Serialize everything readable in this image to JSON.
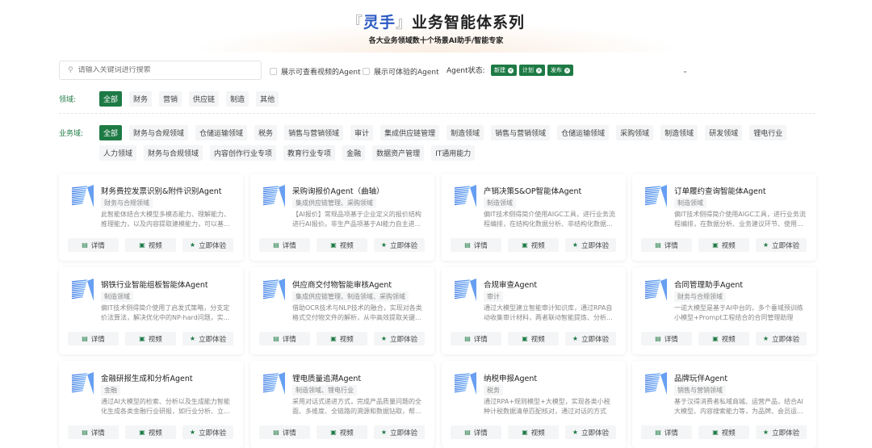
{
  "header": {
    "bracket_open": "『",
    "brand": "灵手",
    "bracket_close": "』",
    "title_rest": "业务智能体系列",
    "subtitle": "各大业务领域数十个场景AI助手/智能专家"
  },
  "search": {
    "placeholder": "请输入关键词进行搜索",
    "value": ""
  },
  "filters": {
    "video_label": "展示可查看视频的Agent",
    "trial_label": "展示可体验的Agent",
    "status_label": "Agent状态:",
    "status_tags": [
      "新建",
      "计划",
      "发布"
    ]
  },
  "domain": {
    "label": "领域:",
    "items": [
      "全部",
      "财务",
      "营销",
      "供应链",
      "制造",
      "其他"
    ],
    "active": 0
  },
  "business": {
    "label": "业务域:",
    "items": [
      "全部",
      "财务与合规领域",
      "仓储运输领域",
      "税务",
      "销售与营销领域",
      "审计",
      "集成供应链管理",
      "制造领域",
      "销售与营销领域",
      "仓储运输领域",
      "采购领域",
      "制造领域",
      "研发领域",
      "锂电行业",
      "人力领域",
      "财务与合规领域",
      "内容创作行业专项",
      "教育行业专项",
      "金融",
      "数据资产管理",
      "IT通用能力"
    ],
    "active": 0
  },
  "buttons": {
    "detail": "详情",
    "video": "视频",
    "try": "立即体验"
  },
  "cards": [
    {
      "title": "财务费控发票识别&附件识别Agent",
      "tag": "财务与合规领域",
      "desc": "此智能体结合大模型多模态能力、理解能力、推理能力，以及内容提取建模能力，可以基..."
    },
    {
      "title": "采购询报价Agent（曲轴）",
      "tag": "集成供应链管理、采购领域",
      "desc": "【AI报价】常规品项基于企业定义的报价结构进行AI报价。非生产品项基于AI能力自主进..."
    },
    {
      "title": "产销决策S&OP智能体Agent",
      "tag": "制造领域",
      "desc": "偏IT技术侧得简介使用AIGC工具，进行业务流程编排，在结构化数据分析、非结构化数据..."
    },
    {
      "title": "订单履约查询智能体Agent",
      "tag": "制造领域",
      "desc": "偏IT技术侧得简介使用AIGC工具，进行业务流程编排，在数据分析、业务建议环节、使用..."
    },
    {
      "title": "钢铁行业智能组板智能体Agent",
      "tag": "制造领域",
      "desc": "偏IT技术侧得简介使用了启发式策略，分支定价法算法，解决优化中的NP-hard问题，实..."
    },
    {
      "title": "供应商交付物智能审核Agent",
      "tag": "集成供应链管理、制造领域、采购领域",
      "desc": "借助OCR技术与NLP技术的融合，实现对各类格式交付物文件的解析，从中高效提取关键..."
    },
    {
      "title": "合规审查Agent",
      "tag": "审计",
      "desc": "通过大模型建立智能审计知识库，通过RPA自动收集审计材料，两者联动智能提炼、分析..."
    },
    {
      "title": "合同管理助手Agent",
      "tag": "财务与合规领域",
      "desc": "一诺大模型是基于AI中台的，多个垂域预训练小模型+Prompt工程结合的合同管理助理"
    },
    {
      "title": "金融研报生成和分析Agent",
      "tag": "金融",
      "desc": "通过AI大模型的检索、分析以及生成能力智能化生成各类金融行业研报，如行业分析、立..."
    },
    {
      "title": "锂电质量追溯Agent",
      "tag": "制造领域、锂电行业",
      "desc": "采用对话式递进方式，完成产品质量问题的全面、多维度、全链路的溯源和数据钻取，帮..."
    },
    {
      "title": "纳税申报Agent",
      "tag": "税务",
      "desc": "通过RPA+规则模型+大模型，实现各类小税种计税数据清单匹配核对，通过对话的方式识..."
    },
    {
      "title": "品牌玩伴Agent",
      "tag": "销售与营销领域",
      "desc": "基于汉得消费者私域商城、运营产品，结合AI大模型、内容搜索能力等，为品牌、会员运..."
    }
  ]
}
